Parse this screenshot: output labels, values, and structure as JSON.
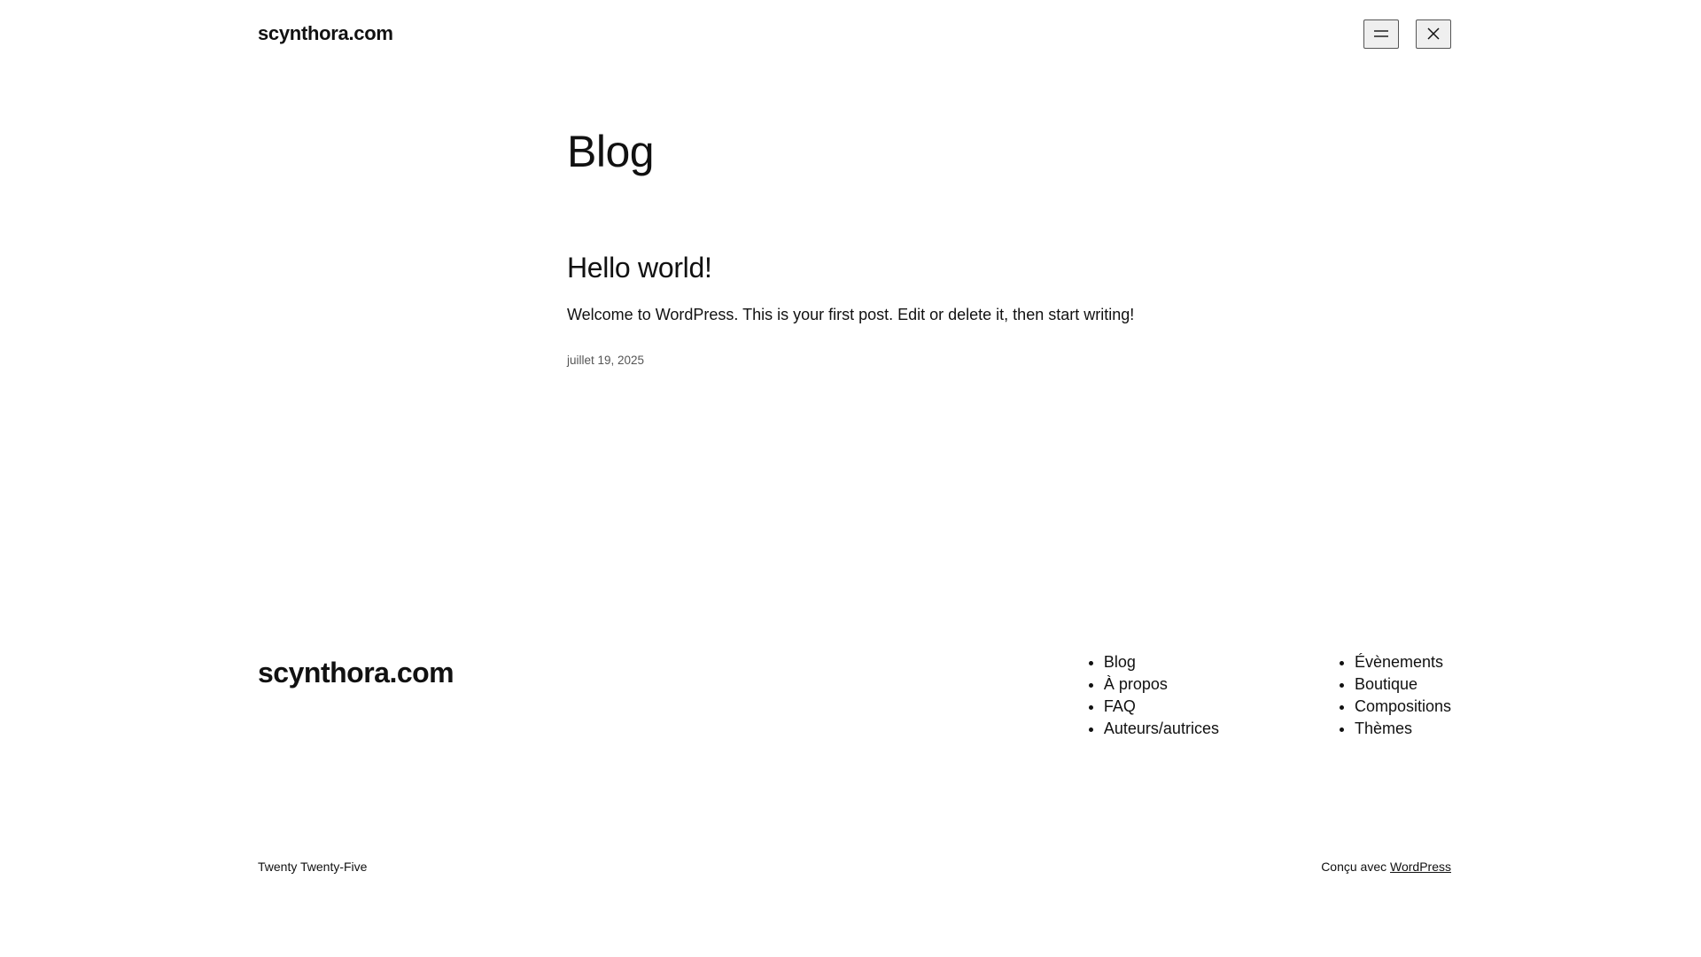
{
  "header": {
    "site_title": "scynthora.com",
    "menu_icon": "hamburger-menu-icon",
    "close_icon": "close-icon"
  },
  "main": {
    "heading": "Blog",
    "post": {
      "title": "Hello world!",
      "excerpt": "Welcome to WordPress. This is your first post. Edit or delete it, then start writing!",
      "date": "juillet 19, 2025"
    }
  },
  "footer": {
    "site_title": "scynthora.com",
    "nav_left": [
      {
        "label": "Blog"
      },
      {
        "label": "À propos"
      },
      {
        "label": "FAQ"
      },
      {
        "label": "Auteurs/autrices"
      }
    ],
    "nav_right": [
      {
        "label": "Évènements"
      },
      {
        "label": "Boutique"
      },
      {
        "label": "Compositions"
      },
      {
        "label": "Thèmes"
      }
    ],
    "theme_name": "Twenty Twenty-Five",
    "credit_prefix": "Conçu avec",
    "credit_link": "WordPress"
  }
}
